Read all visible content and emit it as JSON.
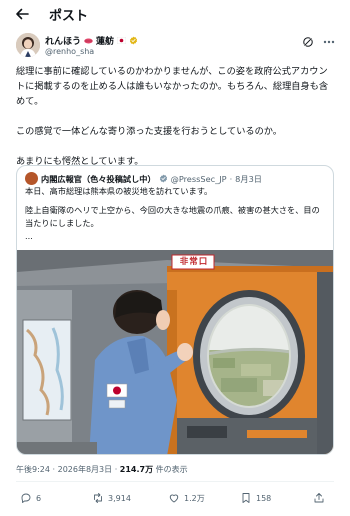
{
  "header": {
    "title": "ポスト"
  },
  "author": {
    "display_name": "れんほう",
    "name_suffix": "蓮舫",
    "handle": "@renho_sha"
  },
  "post": {
    "paragraphs": [
      "総理に事前に確認しているのかわかりませんが、この姿を政府公式アカウントに掲載するのを止める人は誰もいなかったのか。もちろん、総理自身も含めて。",
      "この感覚で一体どんな寄り添った支援を行おうとしているのか。",
      "あまりにも愕然としています。"
    ]
  },
  "quote": {
    "name": "内閣広報官（色々投稿試し中）",
    "handle": "@PressSec_JP",
    "date": "8月3日",
    "line1": "本日、高市総理は熊本県の被災地を訪れています。",
    "line2": "陸上自衛隊のヘリで上空から、今回の大きな地震の爪痕、被害の甚大さを、目の当たりにしました。",
    "ellipsis": "...",
    "sign_text": "非常口"
  },
  "meta": {
    "time": "午後9:24",
    "date": "2026年8月3日",
    "views": "214.7万",
    "views_suffix": "件の表示"
  },
  "actions": {
    "replies": "6",
    "reposts": "3,914",
    "likes": "1.2万",
    "bookmarks": "158"
  },
  "colors": {
    "text": "#0f1419",
    "secondary": "#536471",
    "verified_blue": "#1d9bf0",
    "verified_gold": "#e2b719",
    "heli_orange": "#e0852e",
    "sign_red": "#c0272d"
  },
  "icons": [
    "back-arrow-icon",
    "verified-icon",
    "grok-icon",
    "more-icon",
    "reply-icon",
    "repost-icon",
    "like-icon",
    "bookmark-icon",
    "share-icon"
  ]
}
